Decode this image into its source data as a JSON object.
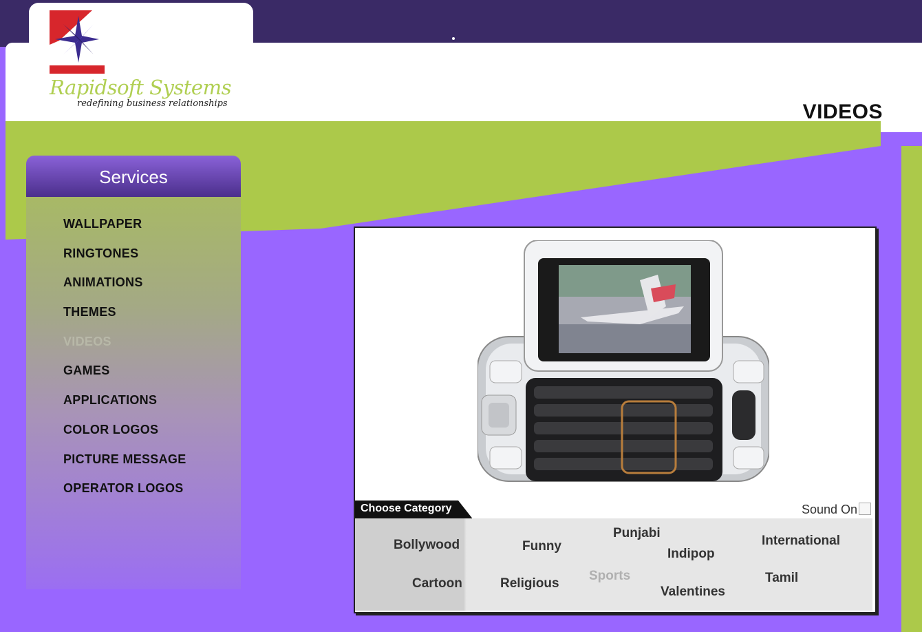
{
  "header": {
    "brand_name": "Rapidsoft Systems",
    "tagline": "redefining business relationships",
    "page_title": "VIDEOS"
  },
  "sidebar": {
    "title": "Services",
    "items": [
      {
        "label": "WALLPAPER",
        "active": false
      },
      {
        "label": "RINGTONES",
        "active": false
      },
      {
        "label": "ANIMATIONS",
        "active": false
      },
      {
        "label": "THEMES",
        "active": false
      },
      {
        "label": "VIDEOS",
        "active": true
      },
      {
        "label": "GAMES",
        "active": false
      },
      {
        "label": "APPLICATIONS",
        "active": false
      },
      {
        "label": "COLOR LOGOS",
        "active": false
      },
      {
        "label": "PICTURE MESSAGE",
        "active": false
      },
      {
        "label": "OPERATOR LOGOS",
        "active": false
      }
    ]
  },
  "player": {
    "image": "mobile-phone-video-preview",
    "choose_category_label": "Choose Category",
    "sound_label": "Sound On",
    "sound_checked": false,
    "categories": [
      {
        "label": "Bollywood"
      },
      {
        "label": "Funny"
      },
      {
        "label": "Punjabi"
      },
      {
        "label": "Indipop"
      },
      {
        "label": "International"
      },
      {
        "label": "Cartoon"
      },
      {
        "label": "Religious"
      },
      {
        "label": "Sports",
        "disabled": true
      },
      {
        "label": "Valentines"
      },
      {
        "label": "Tamil"
      }
    ]
  },
  "colors": {
    "purple": "#9966ff",
    "dark_purple": "#3a2a66",
    "lime": "#acc94a"
  }
}
